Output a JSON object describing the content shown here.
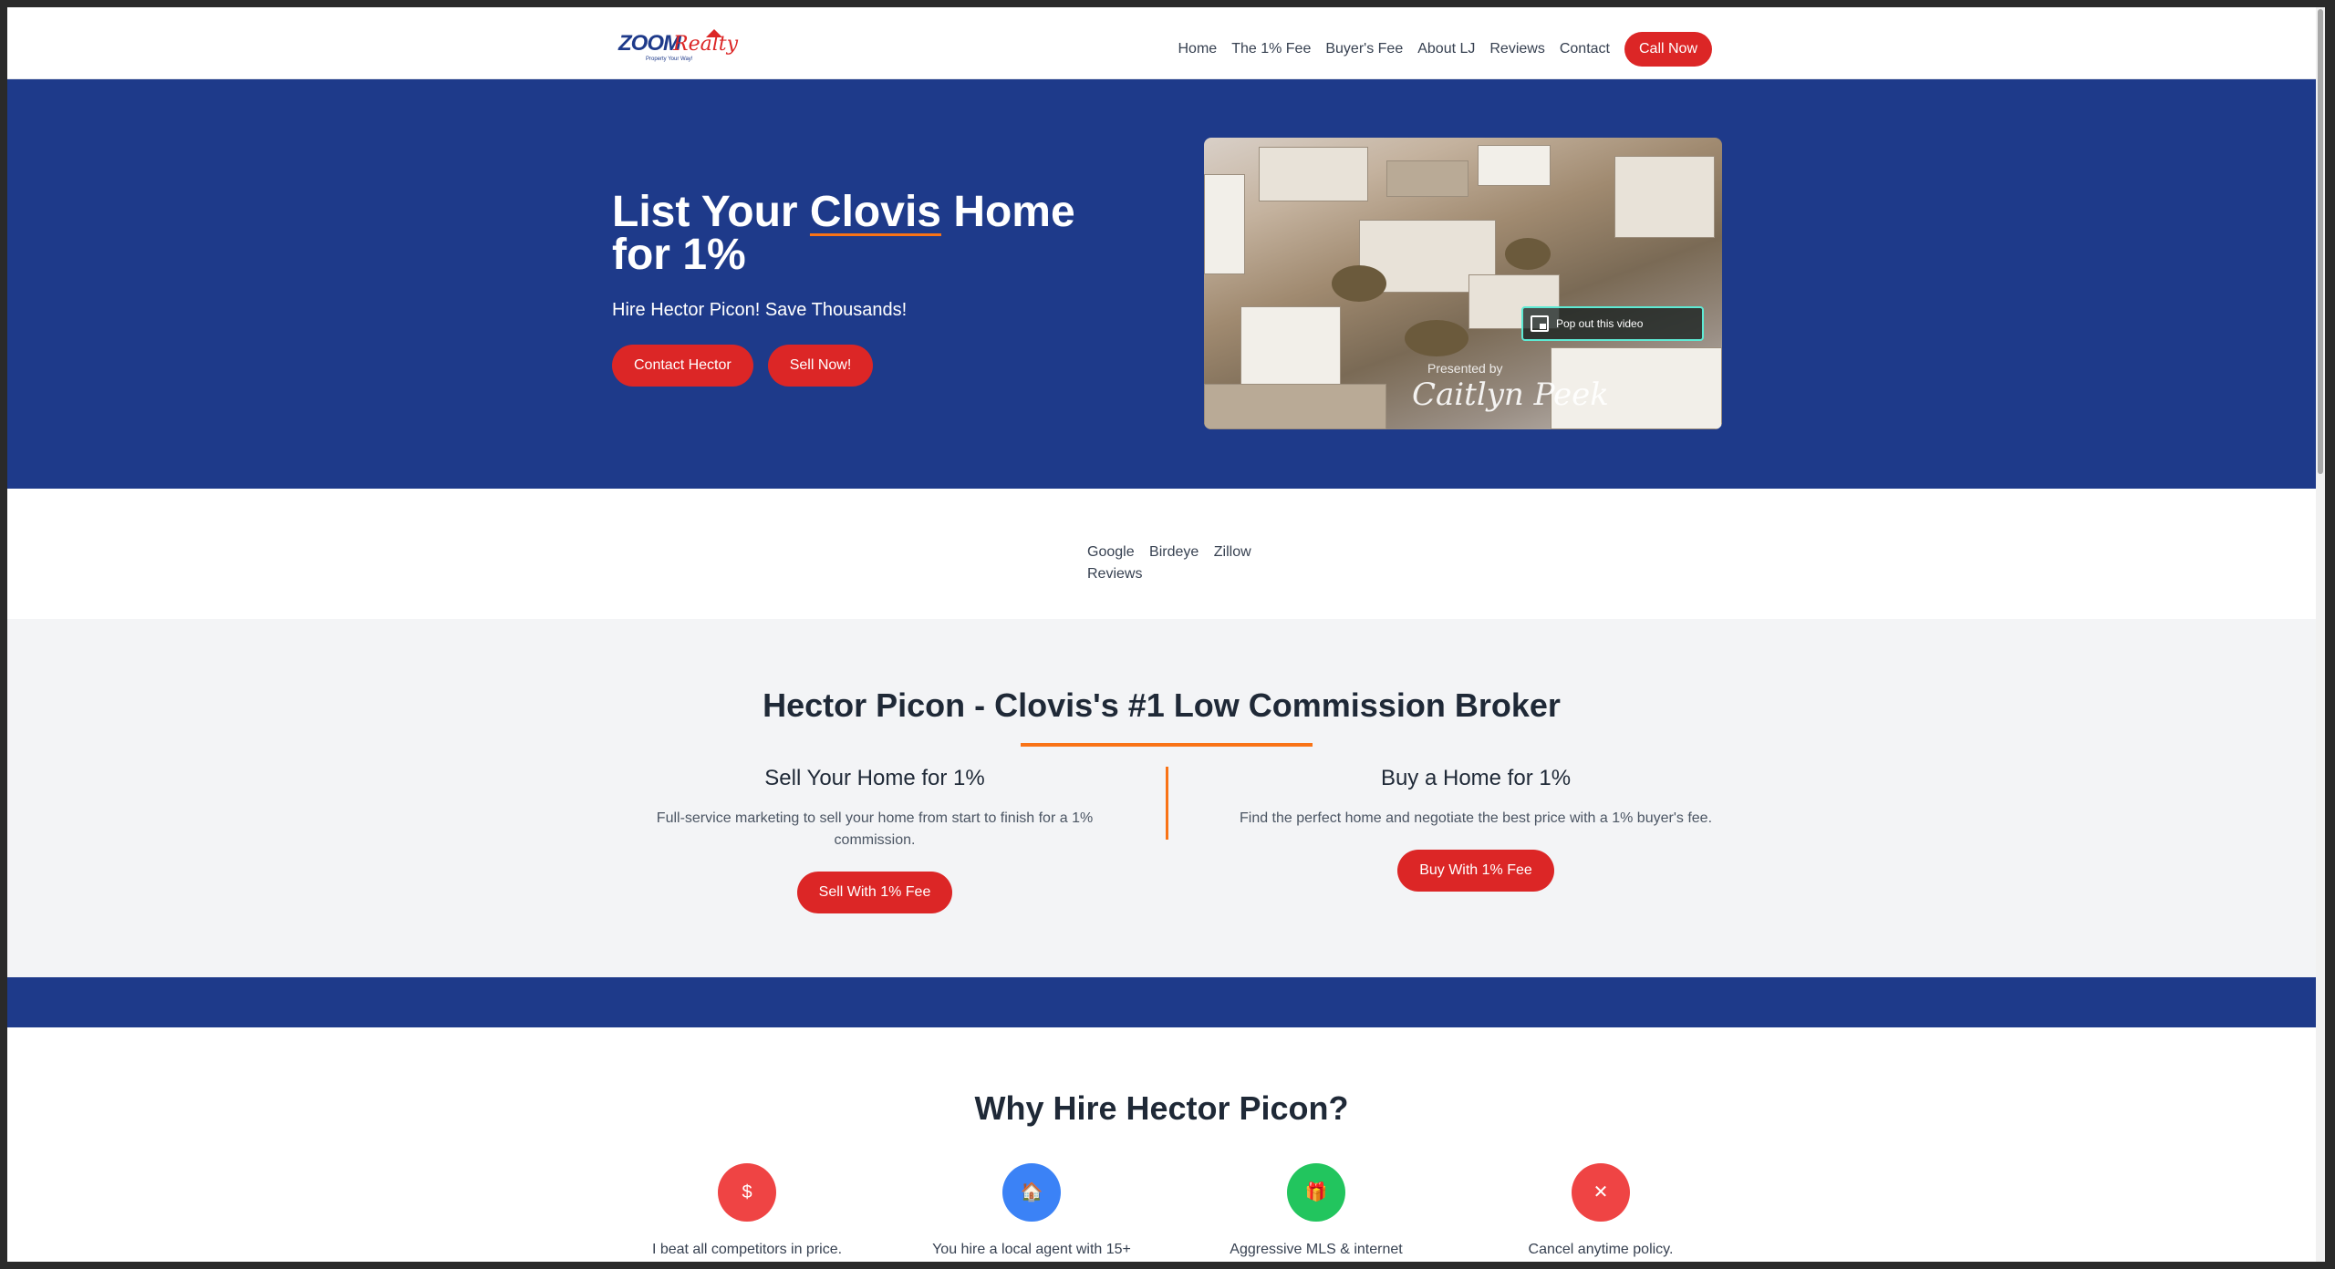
{
  "header": {
    "logo": {
      "brand": "ZOOM",
      "brand2": "Realty",
      "tagline": "Property Your Way!"
    },
    "nav": [
      "Home",
      "The 1% Fee",
      "Buyer's Fee",
      "About LJ",
      "Reviews",
      "Contact"
    ],
    "call_label": "Call Now"
  },
  "hero": {
    "title_pre": "List Your",
    "title_city": "Clovis",
    "title_post": "Home for 1%",
    "subtitle": "Hire Hector Picon! Save Thousands!",
    "btn_contact": "Contact Hector",
    "btn_sell": "Sell Now!",
    "video": {
      "popout_label": "Pop out this video",
      "presented_by": "Presented by",
      "signature": "Caitlyn Peek"
    }
  },
  "reviews": {
    "google": "Google",
    "birdeye": "Birdeye",
    "zillow": "Zillow",
    "reviews": "Reviews"
  },
  "broker": {
    "title": "Hector Picon - Clovis's #1 Low Commission Broker",
    "sell": {
      "heading": "Sell Your Home for 1%",
      "text": "Full-service marketing to sell your home from start to finish for a 1% commission.",
      "button": "Sell With 1% Fee"
    },
    "buy": {
      "heading": "Buy a Home for 1%",
      "text": "Find the perfect home and negotiate the best price with a 1% buyer's fee.",
      "button": "Buy With 1% Fee"
    }
  },
  "why": {
    "title": "Why Hire Hector Picon?",
    "features": [
      {
        "icon": "$",
        "text": "I beat all competitors in price.",
        "color": "#ef4444"
      },
      {
        "icon": "🏠",
        "text": "You hire a local agent with 15+",
        "color": "#3b82f6"
      },
      {
        "icon": "🎁",
        "text": "Aggressive MLS & internet",
        "color": "#22c55e"
      },
      {
        "icon": "✕",
        "text": "Cancel anytime policy.",
        "color": "#ef4444"
      }
    ]
  },
  "colors": {
    "primary_blue": "#1e3a8a",
    "accent_red": "#dc2626",
    "accent_orange": "#f97316"
  }
}
